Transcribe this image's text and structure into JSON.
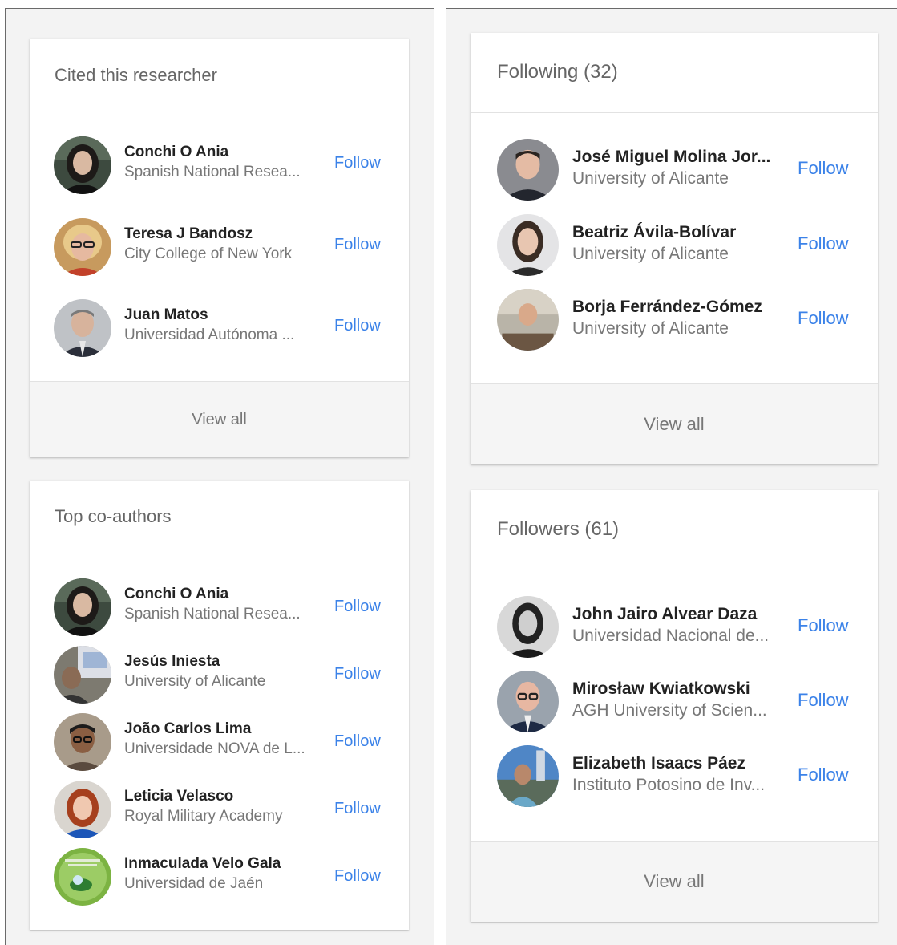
{
  "cited": {
    "title": "Cited this researcher",
    "view_all": "View all",
    "people": [
      {
        "name": "Conchi O Ania",
        "affiliation": "Spanish National Resea...",
        "follow": "Follow"
      },
      {
        "name": "Teresa J Bandosz",
        "affiliation": "City College of New York",
        "follow": "Follow"
      },
      {
        "name": "Juan Matos",
        "affiliation": "Universidad Autónoma ...",
        "follow": "Follow"
      }
    ]
  },
  "coauthors": {
    "title": "Top co-authors",
    "people": [
      {
        "name": "Conchi O Ania",
        "affiliation": "Spanish National Resea...",
        "follow": "Follow"
      },
      {
        "name": "Jesús Iniesta",
        "affiliation": "University of Alicante",
        "follow": "Follow"
      },
      {
        "name": "João Carlos Lima",
        "affiliation": "Universidade NOVA de L...",
        "follow": "Follow"
      },
      {
        "name": "Leticia Velasco",
        "affiliation": "Royal Military Academy",
        "follow": "Follow"
      },
      {
        "name": "Inmaculada Velo Gala",
        "affiliation": "Universidad de Jaén",
        "follow": "Follow"
      }
    ]
  },
  "following": {
    "title": "Following (32)",
    "view_all": "View all",
    "people": [
      {
        "name": "José Miguel Molina Jor...",
        "affiliation": "University of Alicante",
        "follow": "Follow"
      },
      {
        "name": "Beatriz Ávila-Bolívar",
        "affiliation": "University of Alicante",
        "follow": "Follow"
      },
      {
        "name": "Borja Ferrández-Gómez",
        "affiliation": "University of Alicante",
        "follow": "Follow"
      }
    ]
  },
  "followers": {
    "title": "Followers (61)",
    "view_all": "View all",
    "people": [
      {
        "name": "John Jairo Alvear Daza",
        "affiliation": "Universidad Nacional de...",
        "follow": "Follow"
      },
      {
        "name": "Mirosław Kwiatkowski",
        "affiliation": "AGH University of Scien...",
        "follow": "Follow"
      },
      {
        "name": "Elizabeth Isaacs Páez",
        "affiliation": "Instituto Potosino de Inv...",
        "follow": "Follow"
      }
    ]
  },
  "colors": {
    "link": "#3b82e8",
    "page_background": "#f3f3f3"
  }
}
